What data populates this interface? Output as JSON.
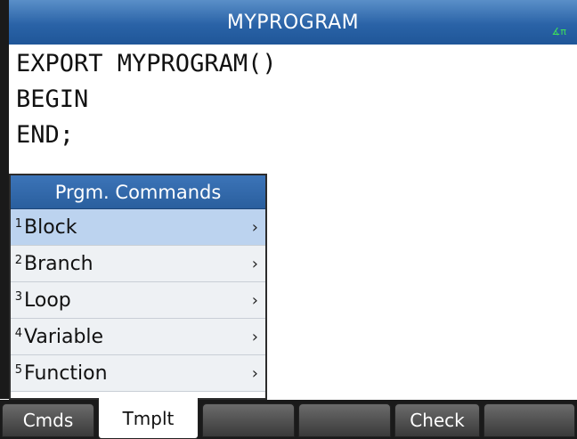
{
  "header": {
    "title": "MYPROGRAM",
    "angle_mode": "∡π"
  },
  "editor": {
    "lines": [
      "EXPORT MYPROGRAM()",
      "BEGIN",
      "END;"
    ]
  },
  "menu": {
    "title": "Prgm. Commands",
    "selected_index": 0,
    "items": [
      {
        "num": "1",
        "label": "Block",
        "chevron": "›"
      },
      {
        "num": "2",
        "label": "Branch",
        "chevron": "›"
      },
      {
        "num": "3",
        "label": "Loop",
        "chevron": "›"
      },
      {
        "num": "4",
        "label": "Variable",
        "chevron": "›"
      },
      {
        "num": "5",
        "label": "Function",
        "chevron": "›"
      }
    ]
  },
  "softkeys": [
    "Cmds",
    "Tmplt",
    "",
    "",
    "Check",
    ""
  ],
  "active_softkey": "Tmplt",
  "colors": {
    "title_bar": "#2a63a7",
    "menu_header": "#3c74b8",
    "selected_item": "#bcd3ef",
    "angle_indicator": "#3ee05a"
  }
}
